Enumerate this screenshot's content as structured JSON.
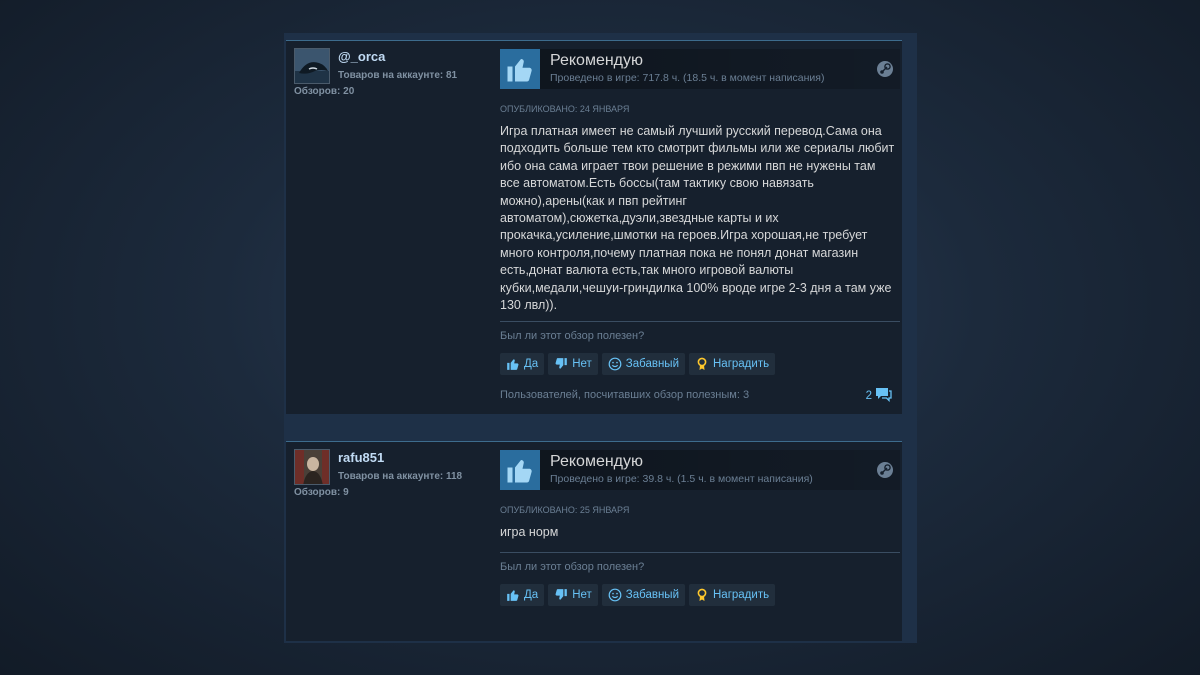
{
  "reviews": [
    {
      "author": "@_orca",
      "games_label": "Товаров на аккаунте: 81",
      "reviews_label": "Обзоров: 20",
      "verdict": "Рекомендую",
      "hours": "Проведено в игре: 717.8 ч. (18.5 ч. в момент написания)",
      "posted": "ОПУБЛИКОВАНО: 24 ЯНВАРЯ",
      "text": "Игра платная имеет не самый лучший русский перевод.Сама она подходить больше тем кто смотрит фильмы или же сериалы любит ибо она сама играет твои решение в режими пвп не нужены там все автоматом.Есть боссы(там тактику свою навязать можно),арены(как и пвп рейтинг автоматом),сюжетка,дуэли,звездные карты и их прокачка,усиление,шмотки на героев.Игра хорошая,не требует много контроля,почему платная пока не понял донат магазин есть,донат валюта есть,так много игровой валюты кубки,медали,чешуи-гриндилка 100% вроде игре 2-3 дня а там уже 130 лвл)).",
      "helpful_question": "Был ли этот обзор полезен?",
      "btn_yes": "Да",
      "btn_no": "Нет",
      "btn_funny": "Забавный",
      "btn_award": "Наградить",
      "helpful_count": "Пользователей, посчитавших обзор полезным: 3",
      "comments": "2"
    },
    {
      "author": "rafu851",
      "games_label": "Товаров на аккаунте: 118",
      "reviews_label": "Обзоров: 9",
      "verdict": "Рекомендую",
      "hours": "Проведено в игре: 39.8 ч. (1.5 ч. в момент написания)",
      "posted": "ОПУБЛИКОВАНО: 25 ЯНВАРЯ",
      "text": "игра норм",
      "helpful_question": "Был ли этот обзор полезен?",
      "btn_yes": "Да",
      "btn_no": "Нет",
      "btn_funny": "Забавный",
      "btn_award": "Наградить"
    }
  ],
  "colors": {
    "accent_link": "#67c1f5",
    "thumb_bg": "#2a6d9e",
    "award_icon": "#ffc82c"
  },
  "icons": [
    "thumbs-up-icon",
    "steam-icon",
    "thumb-up-small-icon",
    "thumb-down-small-icon",
    "smiley-icon",
    "award-icon",
    "comment-icon"
  ]
}
